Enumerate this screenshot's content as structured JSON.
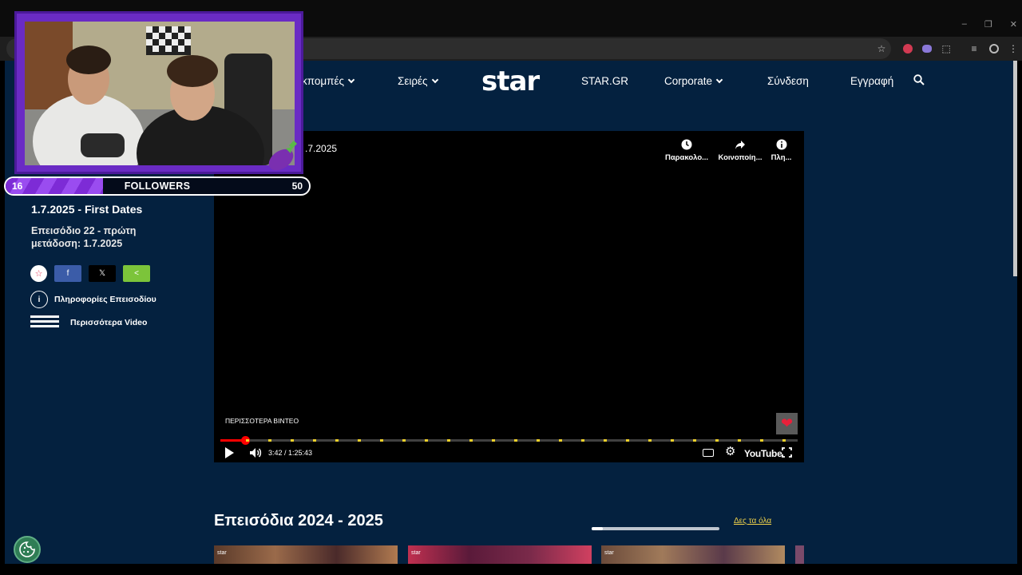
{
  "browser": {
    "window_controls": [
      "–",
      "❐",
      "✕"
    ],
    "toolbar_icons": [
      "bookmark-star-icon",
      "extension-adblock-icon",
      "extension-twitch-icon",
      "extensions-puzzle-icon",
      "media-control-icon",
      "profile-icon",
      "menu-dots-icon"
    ]
  },
  "nav": {
    "items": [
      {
        "label": "κπομπές",
        "dropdown": true
      },
      {
        "label": "Σειρές",
        "dropdown": true
      },
      {
        "label": "STAR.GR",
        "dropdown": false
      },
      {
        "label": "Corporate",
        "dropdown": true
      },
      {
        "label": "Σύνδεση",
        "dropdown": false
      },
      {
        "label": "Εγγραφή",
        "dropdown": false
      }
    ],
    "logo": "star"
  },
  "episode": {
    "title": "1.7.2025 - First Dates",
    "subtitle": "Επεισόδιο 22 - πρώτη μετάδοση: 1.7.2025",
    "share": {
      "star": "☆",
      "facebook": "f",
      "x": "𝕏",
      "share": "<"
    },
    "info_label": "Πληροφορίες Επεισοδίου",
    "more_label": "Περισσότερα Video"
  },
  "player": {
    "title": ".7.2025",
    "watch_later": "Παρακολο...",
    "share": "Κοινοποίη...",
    "info": "Πλη...",
    "more_videos": "ΠΕΡΙΣΣΟΤΕΡΑ ΒΙΝΤΕΟ",
    "time": "3:42 / 1:25:43",
    "progress_fraction": 0.043,
    "youtube": "YouTube",
    "accent": "#ff0000",
    "chapter_color": "#f2d22c"
  },
  "episodes": {
    "title": "Επεισόδια 2024 - 2025",
    "see_all": "Δες τα όλα",
    "thumbs": [
      "star",
      "star",
      "star",
      ""
    ]
  },
  "overlay": {
    "followers_current": "16",
    "followers_label": "FOLLOWERS",
    "followers_goal": "50",
    "followers_fraction": 0.32,
    "brand_color": "#6a2bc4"
  }
}
